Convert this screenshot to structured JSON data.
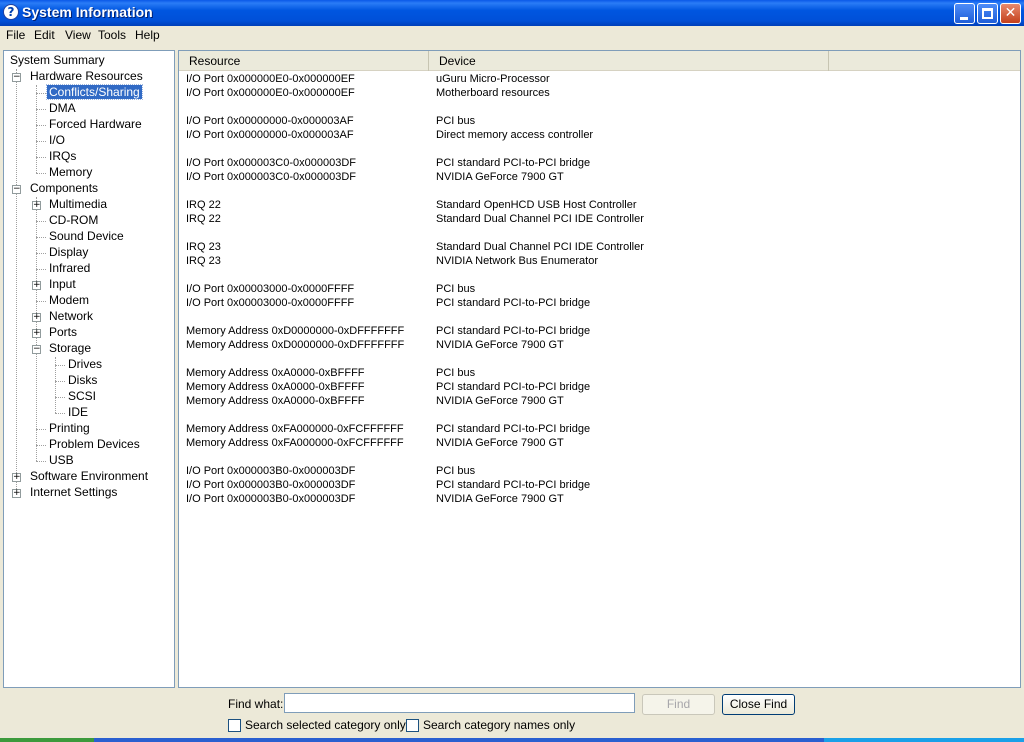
{
  "window": {
    "title": "System Information",
    "icon_glyph": "?",
    "controls": [
      "minimize-icon",
      "maximize-icon",
      "close-icon"
    ],
    "close_glyph": "✕"
  },
  "menu": [
    "File",
    "Edit",
    "View",
    "Tools",
    "Help"
  ],
  "tree": [
    {
      "label": "System Summary",
      "level": 0,
      "expander": "none"
    },
    {
      "label": "Hardware Resources",
      "level": 1,
      "expander": "minus"
    },
    {
      "label": "Conflicts/Sharing",
      "level": 2,
      "expander": "none",
      "selected": true
    },
    {
      "label": "DMA",
      "level": 2,
      "expander": "none"
    },
    {
      "label": "Forced Hardware",
      "level": 2,
      "expander": "none"
    },
    {
      "label": "I/O",
      "level": 2,
      "expander": "none"
    },
    {
      "label": "IRQs",
      "level": 2,
      "expander": "none"
    },
    {
      "label": "Memory",
      "level": 2,
      "expander": "none"
    },
    {
      "label": "Components",
      "level": 1,
      "expander": "minus"
    },
    {
      "label": "Multimedia",
      "level": 2,
      "expander": "plus"
    },
    {
      "label": "CD-ROM",
      "level": 2,
      "expander": "none"
    },
    {
      "label": "Sound Device",
      "level": 2,
      "expander": "none"
    },
    {
      "label": "Display",
      "level": 2,
      "expander": "none"
    },
    {
      "label": "Infrared",
      "level": 2,
      "expander": "none"
    },
    {
      "label": "Input",
      "level": 2,
      "expander": "plus"
    },
    {
      "label": "Modem",
      "level": 2,
      "expander": "none"
    },
    {
      "label": "Network",
      "level": 2,
      "expander": "plus"
    },
    {
      "label": "Ports",
      "level": 2,
      "expander": "plus"
    },
    {
      "label": "Storage",
      "level": 2,
      "expander": "minus"
    },
    {
      "label": "Drives",
      "level": 3,
      "expander": "none"
    },
    {
      "label": "Disks",
      "level": 3,
      "expander": "none"
    },
    {
      "label": "SCSI",
      "level": 3,
      "expander": "none"
    },
    {
      "label": "IDE",
      "level": 3,
      "expander": "none"
    },
    {
      "label": "Printing",
      "level": 2,
      "expander": "none"
    },
    {
      "label": "Problem Devices",
      "level": 2,
      "expander": "none"
    },
    {
      "label": "USB",
      "level": 2,
      "expander": "none"
    },
    {
      "label": "Software Environment",
      "level": 1,
      "expander": "plus"
    },
    {
      "label": "Internet Settings",
      "level": 1,
      "expander": "plus"
    }
  ],
  "list": {
    "columns": [
      "Resource",
      "Device"
    ],
    "groups": [
      [
        [
          "I/O Port 0x000000E0-0x000000EF",
          "uGuru Micro-Processor"
        ],
        [
          "I/O Port 0x000000E0-0x000000EF",
          "Motherboard resources"
        ]
      ],
      [
        [
          "I/O Port 0x00000000-0x000003AF",
          "PCI bus"
        ],
        [
          "I/O Port 0x00000000-0x000003AF",
          "Direct memory access controller"
        ]
      ],
      [
        [
          "I/O Port 0x000003C0-0x000003DF",
          "PCI standard PCI-to-PCI bridge"
        ],
        [
          "I/O Port 0x000003C0-0x000003DF",
          "NVIDIA GeForce 7900 GT"
        ]
      ],
      [
        [
          "IRQ 22",
          "Standard OpenHCD USB Host Controller"
        ],
        [
          "IRQ 22",
          "Standard Dual Channel PCI IDE Controller"
        ]
      ],
      [
        [
          "IRQ 23",
          "Standard Dual Channel PCI IDE Controller"
        ],
        [
          "IRQ 23",
          "NVIDIA Network Bus Enumerator"
        ]
      ],
      [
        [
          "I/O Port 0x00003000-0x0000FFFF",
          "PCI bus"
        ],
        [
          "I/O Port 0x00003000-0x0000FFFF",
          "PCI standard PCI-to-PCI bridge"
        ]
      ],
      [
        [
          "Memory Address 0xD0000000-0xDFFFFFFF",
          "PCI standard PCI-to-PCI bridge"
        ],
        [
          "Memory Address 0xD0000000-0xDFFFFFFF",
          "NVIDIA GeForce 7900 GT"
        ]
      ],
      [
        [
          "Memory Address 0xA0000-0xBFFFF",
          "PCI bus"
        ],
        [
          "Memory Address 0xA0000-0xBFFFF",
          "PCI standard PCI-to-PCI bridge"
        ],
        [
          "Memory Address 0xA0000-0xBFFFF",
          "NVIDIA GeForce 7900 GT"
        ]
      ],
      [
        [
          "Memory Address 0xFA000000-0xFCFFFFFF",
          "PCI standard PCI-to-PCI bridge"
        ],
        [
          "Memory Address 0xFA000000-0xFCFFFFFF",
          "NVIDIA GeForce 7900 GT"
        ]
      ],
      [
        [
          "I/O Port 0x000003B0-0x000003DF",
          "PCI bus"
        ],
        [
          "I/O Port 0x000003B0-0x000003DF",
          "PCI standard PCI-to-PCI bridge"
        ],
        [
          "I/O Port 0x000003B0-0x000003DF",
          "NVIDIA GeForce 7900 GT"
        ]
      ]
    ]
  },
  "find": {
    "label": "Find what:",
    "value": "",
    "find_button": "Find",
    "find_button_enabled": false,
    "close_button": "Close Find",
    "check_selected": {
      "label": "Search selected category only",
      "checked": false
    },
    "check_names": {
      "label": "Search category names only",
      "checked": false
    }
  },
  "colors": {
    "titlebar": "#0054e3",
    "selection": "#316ac5",
    "chrome": "#ece9d8"
  }
}
